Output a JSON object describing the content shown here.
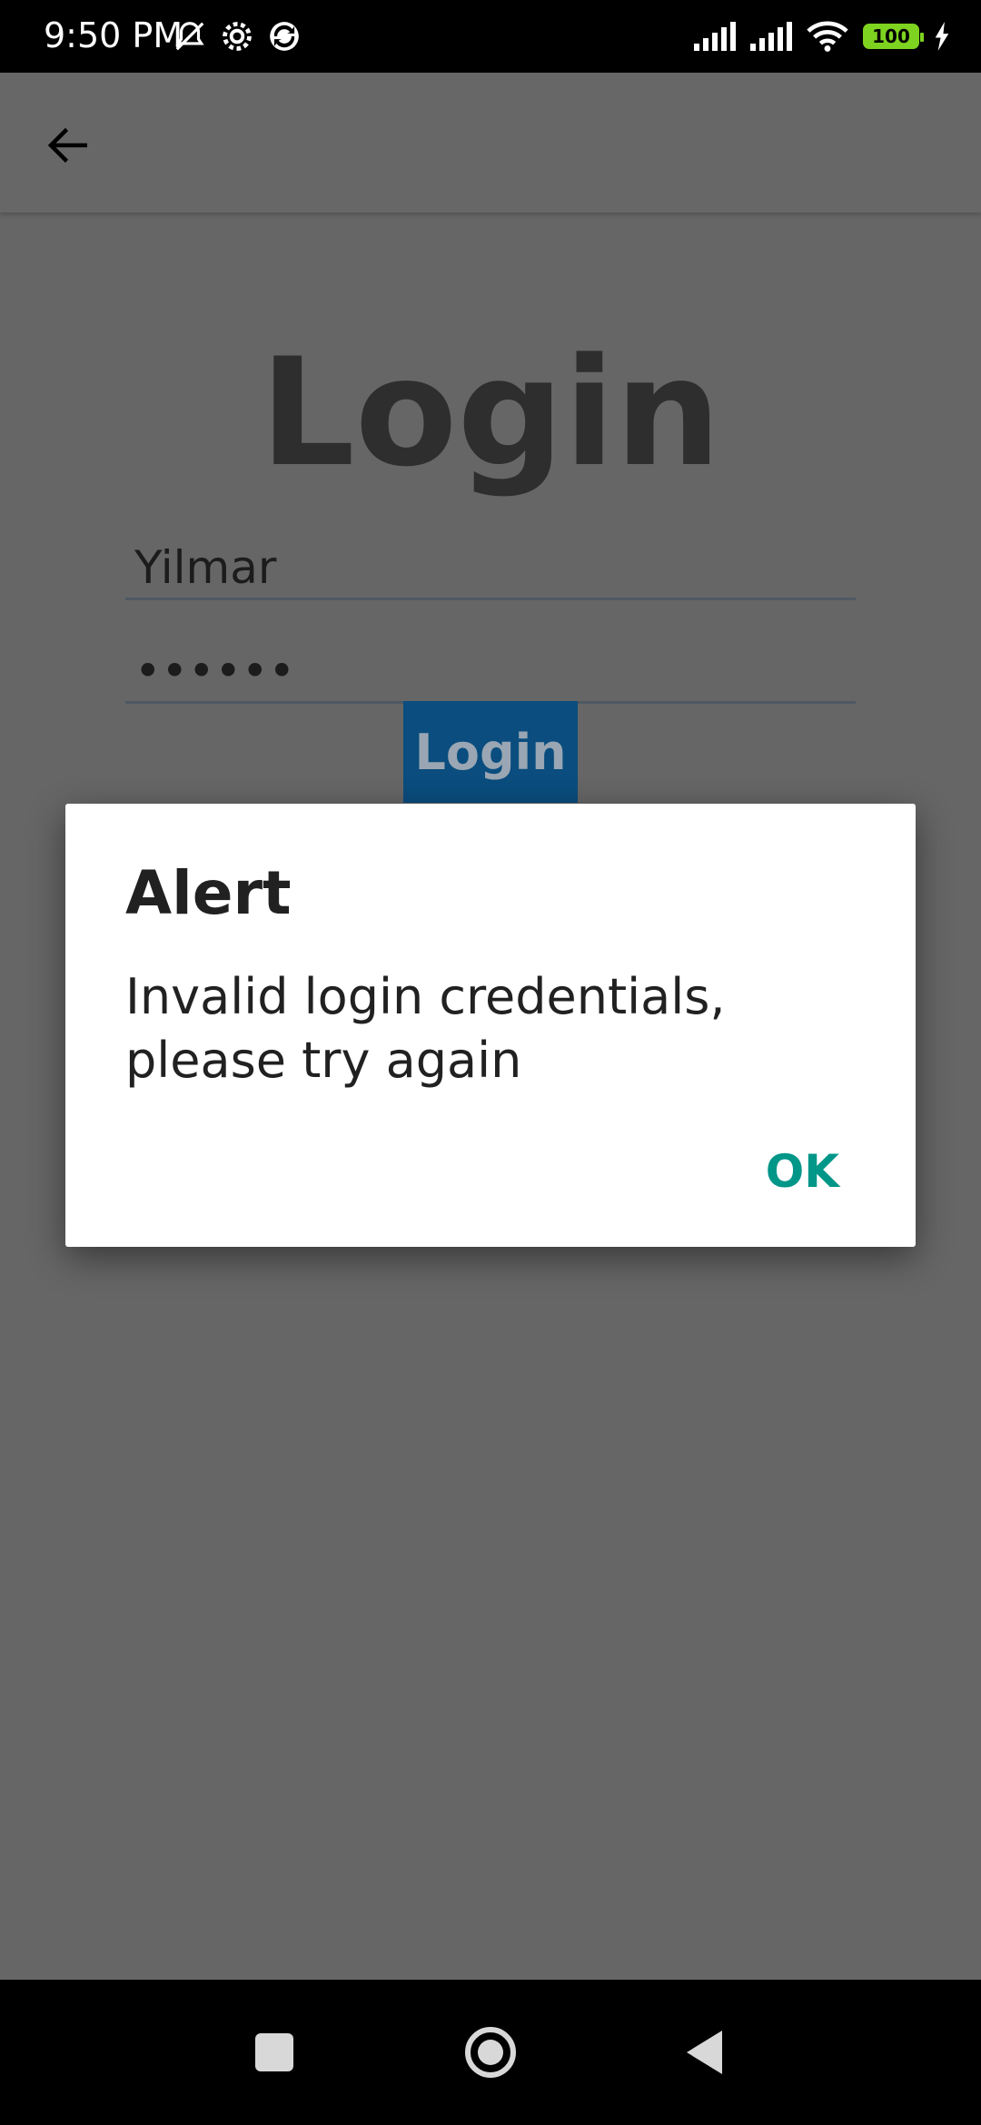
{
  "status_bar": {
    "time": "9:50 PM",
    "battery_level": "100",
    "icons": [
      "mute-icon",
      "settings-icon",
      "sync-icon",
      "signal-icon",
      "signal-icon",
      "wifi-icon",
      "battery-icon",
      "charging-icon"
    ]
  },
  "app_bar": {
    "back_icon": "back-arrow-icon"
  },
  "login_form": {
    "title": "Login",
    "username_value": "Yilmar",
    "password_value": "••••••",
    "login_button_label": "Login"
  },
  "alert_dialog": {
    "title": "Alert",
    "message": "Invalid login credentials, please try again",
    "ok_label": "OK"
  },
  "nav_bar": {
    "icons": [
      "recents-icon",
      "home-icon",
      "back-icon"
    ]
  },
  "colors": {
    "scrim_background": "#666666",
    "dialog_background": "#ffffff",
    "accent": "#009688",
    "login_button": "#0a4d7e"
  }
}
